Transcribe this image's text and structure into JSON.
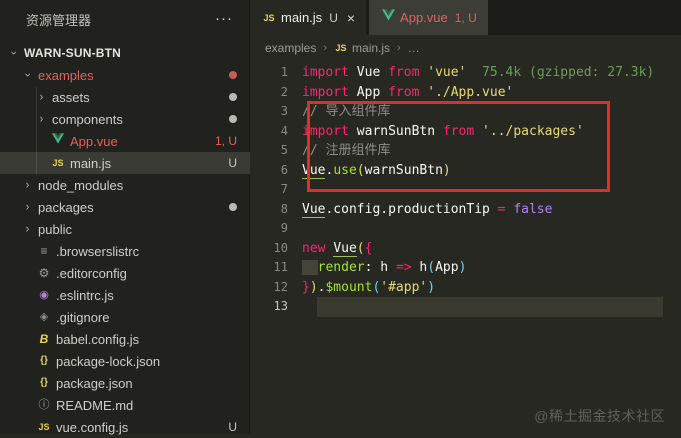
{
  "sidebar": {
    "title": "资源管理器",
    "more_icon": "···",
    "items": [
      {
        "label": "WARN-SUN-BTN",
        "chev": "down",
        "icon": "none",
        "indent": 0,
        "style": "bold"
      },
      {
        "label": "examples",
        "chev": "down",
        "icon": "none",
        "indent": 1,
        "style": "red",
        "badge": "dot-red"
      },
      {
        "label": "assets",
        "chev": "right",
        "icon": "none",
        "indent": 2,
        "badge": "dot-gray"
      },
      {
        "label": "components",
        "chev": "right",
        "icon": "none",
        "indent": 2,
        "badge": "dot-gray"
      },
      {
        "label": "App.vue",
        "chev": "none",
        "icon": "vue",
        "indent": 2,
        "style": "red",
        "badge": "1, U"
      },
      {
        "label": "main.js",
        "chev": "none",
        "icon": "js",
        "indent": 2,
        "selected": true,
        "badge": "U"
      },
      {
        "label": "node_modules",
        "chev": "right",
        "icon": "none",
        "indent": 1
      },
      {
        "label": "packages",
        "chev": "right",
        "icon": "none",
        "indent": 1,
        "badge": "dot-gray"
      },
      {
        "label": "public",
        "chev": "right",
        "icon": "none",
        "indent": 1
      },
      {
        "label": ".browserslistrc",
        "chev": "none",
        "icon": "list",
        "indent": 1
      },
      {
        "label": ".editorconfig",
        "chev": "none",
        "icon": "gear",
        "indent": 1
      },
      {
        "label": ".eslintrc.js",
        "chev": "none",
        "icon": "eslint",
        "indent": 1
      },
      {
        "label": ".gitignore",
        "chev": "none",
        "icon": "diamond",
        "indent": 1
      },
      {
        "label": "babel.config.js",
        "chev": "none",
        "icon": "babel",
        "indent": 1
      },
      {
        "label": "package-lock.json",
        "chev": "none",
        "icon": "braces",
        "indent": 1
      },
      {
        "label": "package.json",
        "chev": "none",
        "icon": "braces",
        "indent": 1
      },
      {
        "label": "README.md",
        "chev": "none",
        "icon": "info",
        "indent": 1
      },
      {
        "label": "vue.config.js",
        "chev": "none",
        "icon": "js",
        "indent": 1,
        "badge": "U"
      }
    ]
  },
  "tabs": [
    {
      "label": "main.js",
      "icon": "js",
      "badge": "U",
      "close": "×",
      "active": true
    },
    {
      "label": "App.vue",
      "icon": "vue",
      "badge": "1, U",
      "active": false
    }
  ],
  "breadcrumb": {
    "items": [
      "examples",
      "main.js",
      "…"
    ],
    "separator": "›"
  },
  "editor": {
    "language": "javascript",
    "annotation": {
      "shape": "red-box",
      "covers_lines": "3-6"
    },
    "current_line": 13,
    "import_cost": "75.4k (gzipped: 27.3k)",
    "lines": [
      {
        "n": "1",
        "tokens": [
          [
            "import",
            "kw"
          ],
          [
            " Vue ",
            "fg"
          ],
          [
            "from",
            "kw"
          ],
          [
            " ",
            "fg"
          ],
          [
            "'vue'",
            "str"
          ],
          [
            "  75.4k (gzipped: 27.3k)",
            "cost"
          ]
        ]
      },
      {
        "n": "2",
        "tokens": [
          [
            "import",
            "kw"
          ],
          [
            " App ",
            "fg"
          ],
          [
            "from",
            "kw"
          ],
          [
            " ",
            "fg"
          ],
          [
            "'./App.vue'",
            "str"
          ]
        ]
      },
      {
        "n": "3",
        "tokens": [
          [
            "// 导入组件库",
            "cmt"
          ]
        ]
      },
      {
        "n": "4",
        "tokens": [
          [
            "import",
            "kw"
          ],
          [
            " warnSunBtn ",
            "fg"
          ],
          [
            "from",
            "kw"
          ],
          [
            " ",
            "fg"
          ],
          [
            "'../packages'",
            "str"
          ]
        ]
      },
      {
        "n": "5",
        "tokens": [
          [
            "// 注册组件库",
            "cmt"
          ]
        ]
      },
      {
        "n": "6",
        "tokens": [
          [
            "Vue",
            "und"
          ],
          [
            ".",
            "fg"
          ],
          [
            "use",
            "fn"
          ],
          [
            "(",
            "py"
          ],
          [
            "warnSunBtn",
            "fg"
          ],
          [
            ")",
            "py"
          ]
        ]
      },
      {
        "n": "7",
        "tokens": []
      },
      {
        "n": "8",
        "tokens": [
          [
            "Vue",
            "und"
          ],
          [
            ".config.productionTip ",
            "fg"
          ],
          [
            "=",
            "kw"
          ],
          [
            " ",
            "fg"
          ],
          [
            "false",
            "pur"
          ]
        ]
      },
      {
        "n": "9",
        "tokens": []
      },
      {
        "n": "10",
        "tokens": [
          [
            "new",
            "kw"
          ],
          [
            " ",
            "fg"
          ],
          [
            "Vue",
            "und"
          ],
          [
            "(",
            "py"
          ],
          [
            "{",
            "pp"
          ]
        ]
      },
      {
        "n": "11",
        "tokens": [
          [
            "  ",
            "ind"
          ],
          [
            "render",
            "fn"
          ],
          [
            ": h ",
            "fg"
          ],
          [
            "=>",
            "kw"
          ],
          [
            " h",
            "fg"
          ],
          [
            "(",
            "blu"
          ],
          [
            "App",
            "fg"
          ],
          [
            ")",
            "blu"
          ]
        ]
      },
      {
        "n": "12",
        "tokens": [
          [
            "}",
            "pp"
          ],
          [
            ")",
            "py"
          ],
          [
            ".",
            "fg"
          ],
          [
            "$mount",
            "fn"
          ],
          [
            "(",
            "blu"
          ],
          [
            "'#app'",
            "str"
          ],
          [
            ")",
            "blu"
          ]
        ]
      },
      {
        "n": "13",
        "tokens": []
      }
    ]
  },
  "watermark": "@稀土掘金技术社区",
  "colors": {
    "editor_bg": "#272822",
    "sidebar_bg": "#21221e",
    "tabbar_bg": "#1b1c17",
    "inactive_tab_bg": "#3b3d36",
    "keyword": "#f92672",
    "string": "#e6db74",
    "function": "#a6e22e",
    "constant": "#ae81ff",
    "comment": "#8f8f87",
    "paren_blue": "#66d9ef",
    "error_red": "#e2625e",
    "annotation_red": "#df3028",
    "import_cost_green": "#6a9e55"
  }
}
